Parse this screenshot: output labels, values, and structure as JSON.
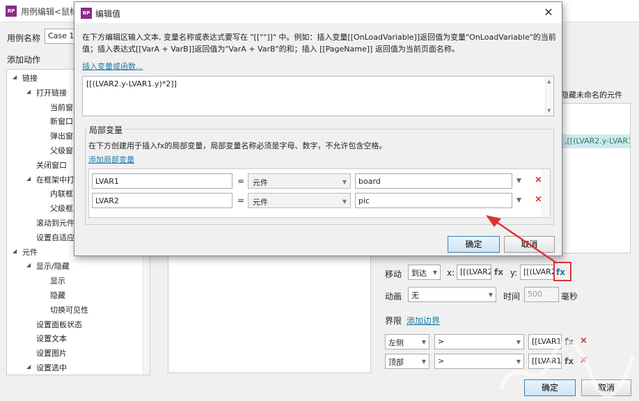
{
  "background": {
    "window_title": "用例编辑<鼠标",
    "case_name_label": "用例名称",
    "case_name_value": "Case 1",
    "add_action_label": "添加动作",
    "tree": [
      {
        "label": "链接",
        "level": 0,
        "arrow": true
      },
      {
        "label": "打开链接",
        "level": 1,
        "arrow": true
      },
      {
        "label": "当前窗",
        "level": 2,
        "arrow": false
      },
      {
        "label": "新窗口",
        "level": 2,
        "arrow": false
      },
      {
        "label": "弹出窗",
        "level": 2,
        "arrow": false
      },
      {
        "label": "父级窗",
        "level": 2,
        "arrow": false
      },
      {
        "label": "关闭窗口",
        "level": 1,
        "arrow": false
      },
      {
        "label": "在框架中打",
        "level": 1,
        "arrow": true
      },
      {
        "label": "内联框",
        "level": 2,
        "arrow": false
      },
      {
        "label": "父级框",
        "level": 2,
        "arrow": false
      },
      {
        "label": "滚动到元件",
        "level": 1,
        "arrow": false
      },
      {
        "label": "设置自适应",
        "level": 1,
        "arrow": false
      },
      {
        "label": "元件",
        "level": 0,
        "arrow": true
      },
      {
        "label": "显示/隐藏",
        "level": 1,
        "arrow": true
      },
      {
        "label": "显示",
        "level": 2,
        "arrow": false
      },
      {
        "label": "隐藏",
        "level": 2,
        "arrow": false
      },
      {
        "label": "切换可见性",
        "level": 2,
        "arrow": false
      },
      {
        "label": "设置面板状态",
        "level": 1,
        "arrow": false
      },
      {
        "label": "设置文本",
        "level": 1,
        "arrow": false
      },
      {
        "label": "设置图片",
        "level": 1,
        "arrow": false
      },
      {
        "label": "设置选中",
        "level": 1,
        "arrow": true
      }
    ],
    "right_header": "隐藏未命名的元件",
    "right_list_row": ",[[(LVAR2.y-LVAR1.",
    "move": {
      "label": "移动",
      "mode": "到达",
      "x_label": "x:",
      "x_value": "[[(LVAR2",
      "y_label": "y:",
      "y_value": "[[(LVAR2"
    },
    "fx": "fx",
    "animation": {
      "label": "动画",
      "value": "无",
      "time_label": "时间",
      "time_value": "500",
      "unit": "毫秒"
    },
    "bounds": {
      "label": "界限",
      "add_link": "添加边界",
      "rows": [
        {
          "side": "左侧",
          "op": ">",
          "value": "[[LVAR1."
        },
        {
          "side": "顶部",
          "op": ">",
          "value": "[[LVAR1."
        }
      ]
    },
    "ok_label": "确定",
    "cancel_label": "取消",
    "delete_icon": "×"
  },
  "dialog": {
    "title": "编辑值",
    "close_glyph": "✕",
    "description": "在下方编辑区输入文本, 变量名称或表达式要写在 \"[[\"\"]]\" 中。例如：插入变量[[OnLoadVariable]]返回值为变量\"OnLoadVariable\"的当前值；插入表达式[[VarA + VarB]]返回值为\"VarA + VarB\"的和；插入 [[PageName]] 返回值为当前页面名称。",
    "insert_link": "插入变量或函数...",
    "expression": "[[(LVAR2.y-LVAR1.y)*2]]",
    "local_vars": {
      "legend": "局部变量",
      "description": "在下方创建用于插入fx的局部变量，局部变量名称必须是字母、数字，不允许包含空格。",
      "add_link": "添加局部变量",
      "rows": [
        {
          "name": "LVAR1",
          "eq": "=",
          "type": "元件",
          "value": "board"
        },
        {
          "name": "LVAR2",
          "eq": "=",
          "type": "元件",
          "value": "pic"
        }
      ]
    },
    "ok_label": "确定",
    "cancel_label": "取消"
  },
  "colors": {
    "accent_link": "#1a7aa8",
    "highlight_red": "#dd3333",
    "logo_purple": "#8b2a8b"
  }
}
